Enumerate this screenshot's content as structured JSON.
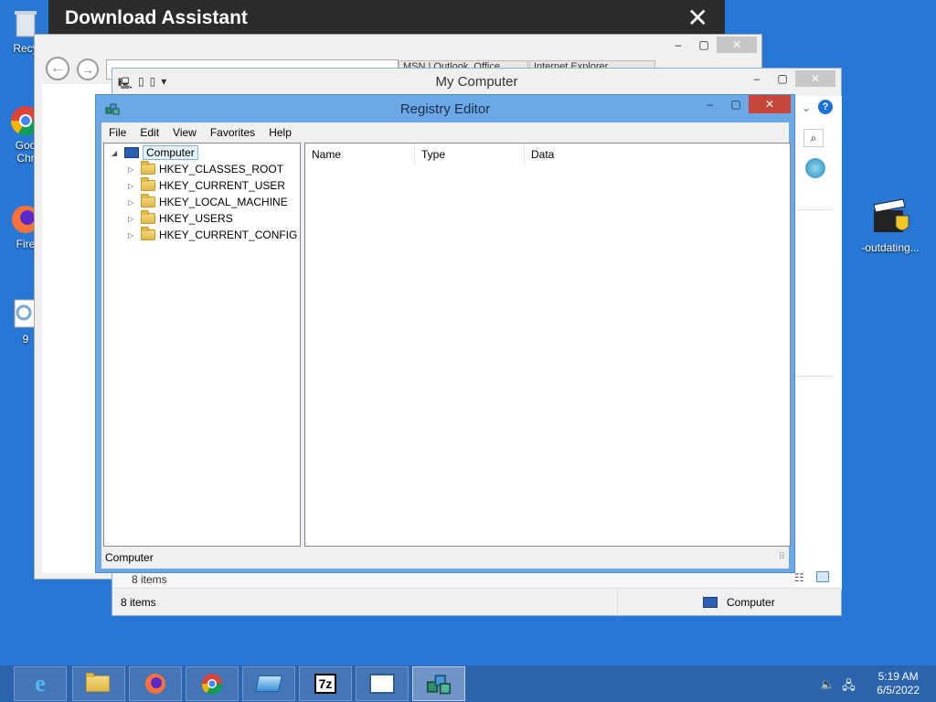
{
  "desktop": {
    "icons": [
      {
        "label": "Recy"
      },
      {
        "label": "Goo"
      },
      {
        "label": "Chr"
      },
      {
        "label": "Fire"
      },
      {
        "label": "9"
      },
      {
        "label": "-outdating..."
      }
    ]
  },
  "download_assistant": {
    "title": "Download Assistant",
    "close": "✕"
  },
  "ie": {
    "tabs": [
      "MSN | Outlook, Office...",
      "Internet Explorer..."
    ]
  },
  "my_computer": {
    "title": "My Computer",
    "status_items": "8 items",
    "inner_status": "8 items",
    "location": "Computer"
  },
  "regedit": {
    "title": "Registry Editor",
    "menu": [
      "File",
      "Edit",
      "View",
      "Favorites",
      "Help"
    ],
    "tree": {
      "root": "Computer",
      "keys": [
        "HKEY_CLASSES_ROOT",
        "HKEY_CURRENT_USER",
        "HKEY_LOCAL_MACHINE",
        "HKEY_USERS",
        "HKEY_CURRENT_CONFIG"
      ]
    },
    "columns": [
      "Name",
      "Type",
      "Data"
    ],
    "status": "Computer"
  },
  "taskbar": {
    "time": "5:19 AM",
    "date": "6/5/2022"
  }
}
